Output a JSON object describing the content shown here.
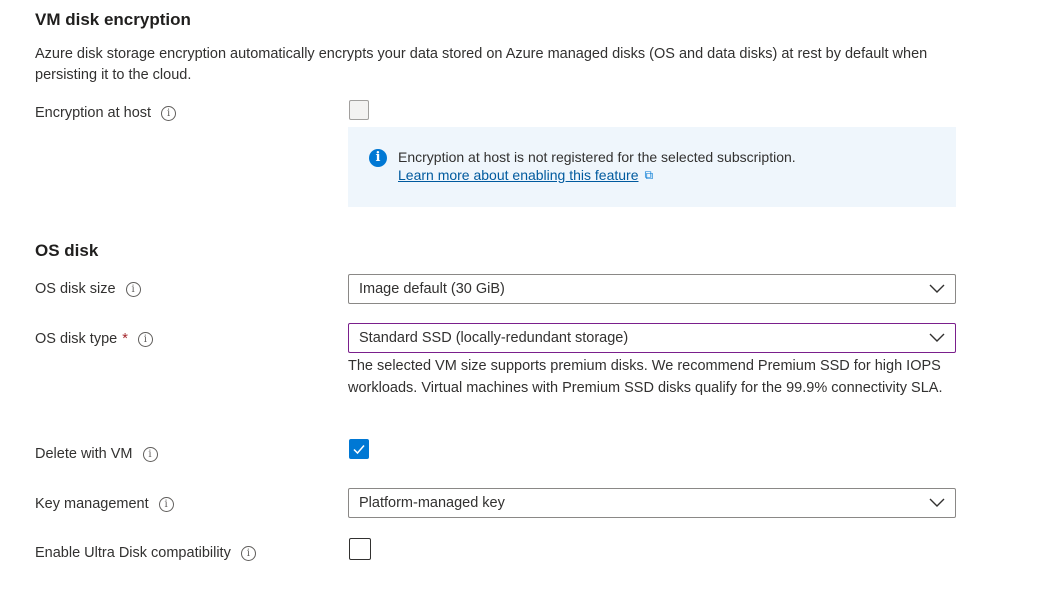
{
  "vm_disk_encryption": {
    "heading": "VM disk encryption",
    "description": "Azure disk storage encryption automatically encrypts your data stored on Azure managed disks (OS and data disks) at rest by default when persisting it to the cloud.",
    "encryption_at_host_label": "Encryption at host",
    "encryption_at_host_checked": false,
    "encryption_at_host_disabled": true,
    "info_message": "Encryption at host is not registered for the selected subscription.",
    "info_link": "Learn more about enabling this feature"
  },
  "os_disk": {
    "heading": "OS disk",
    "size_label": "OS disk size",
    "size_value": "Image default (30 GiB)",
    "type_label": "OS disk type",
    "type_required_marker": "*",
    "type_value": "Standard SSD (locally-redundant storage)",
    "type_help": "The selected VM size supports premium disks. We recommend Premium SSD for high IOPS workloads. Virtual machines with Premium SSD disks qualify for the 99.9% connectivity SLA.",
    "delete_with_vm_label": "Delete with VM",
    "delete_with_vm_checked": true,
    "key_management_label": "Key management",
    "key_management_value": "Platform-managed key",
    "ultra_disk_label": "Enable Ultra Disk compatibility",
    "ultra_disk_checked": false
  },
  "icons": {
    "info": "i",
    "external": "⧉"
  },
  "colors": {
    "accent": "#0078d4",
    "info_background": "#eff6fc",
    "required": "#a4262c",
    "focus_border": "#7a1f8c"
  }
}
